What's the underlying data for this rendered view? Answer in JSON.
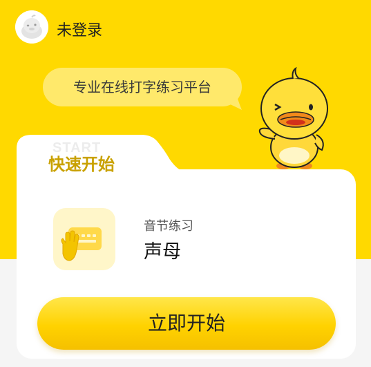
{
  "header": {
    "login_status": "未登录",
    "avatar_icon": "duck-avatar-icon"
  },
  "banner": {
    "slogan": "专业在线打字练习平台",
    "mascot_icon": "duck-mascot-icon"
  },
  "quick_start": {
    "watermark": "START",
    "title": "快速开始",
    "icon": "keyboard-hand-icon",
    "category": "音节练习",
    "lesson": "声母",
    "start_button": "立即开始"
  },
  "colors": {
    "primary_yellow": "#ffd900",
    "accent_gold": "#c9a100",
    "bubble_yellow": "#ffe96b",
    "background_gray": "#f5f5f5"
  }
}
